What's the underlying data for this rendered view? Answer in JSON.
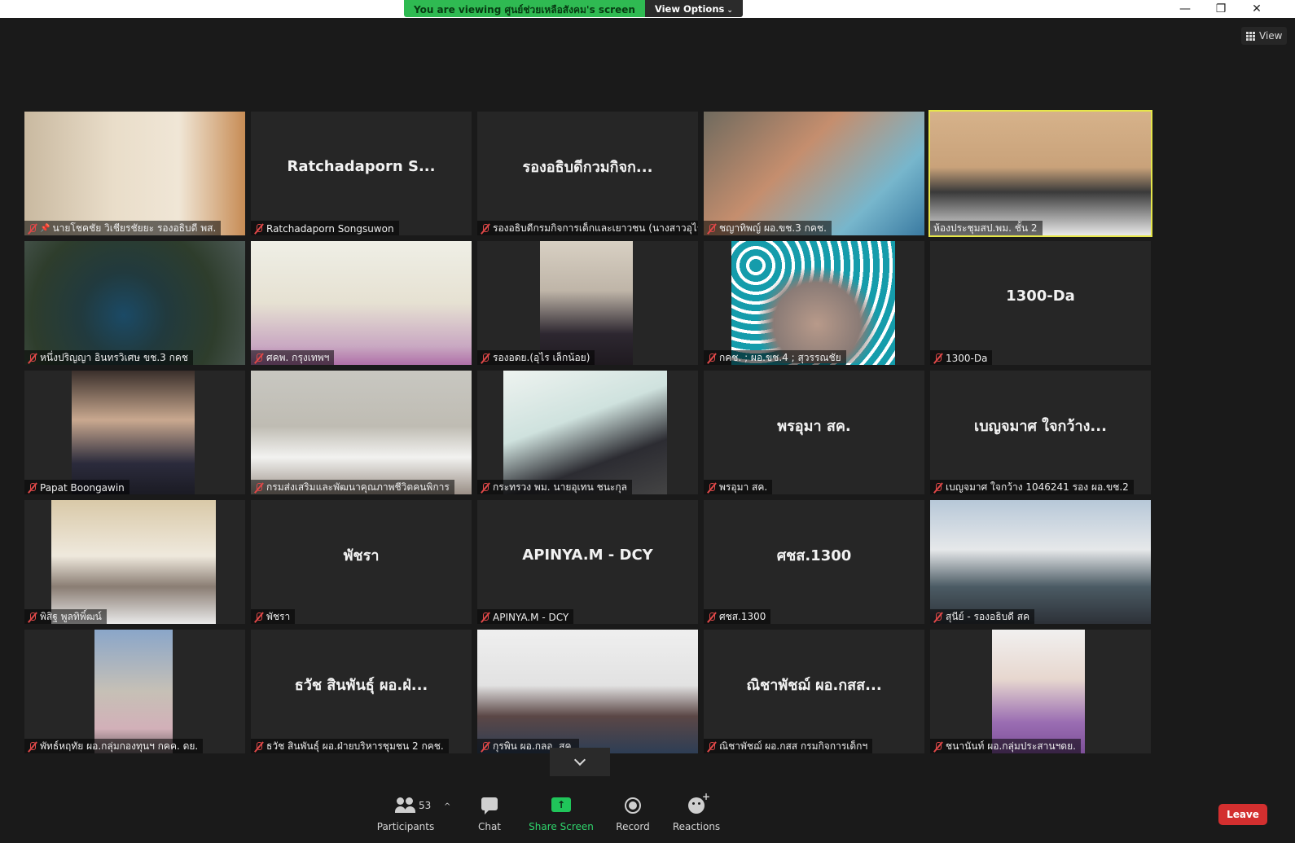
{
  "banner": {
    "text": "You are viewing ศูนย์ช่วยเหลือสังคม's screen",
    "options_label": "View Options"
  },
  "window": {
    "minimize": "—",
    "restore": "❐",
    "close": "✕"
  },
  "view_button": {
    "label": "View"
  },
  "tiles": [
    {
      "label": "นายโชคชัย วิเชียรชัยยะ รองอธิบดี พส.",
      "big": "",
      "pinned": true
    },
    {
      "label": "Ratchadaporn Songsuwon",
      "big": "Ratchadaporn S..."
    },
    {
      "label": "รองอธิบดีกรมกิจการเด็กและเยาวชน (นางสาวอุไร ...",
      "big": "รองอธิบดีกวมกิจก..."
    },
    {
      "label": "ชญาทิพญ์ ผอ.ขช.3 กคช.",
      "big": ""
    },
    {
      "label": "ห้องประชุมสป.พม. ชั้น 2",
      "big": "",
      "active": true
    },
    {
      "label": "หนึ่งปริญญา อินทรวิเศษ ขช.3 กคช",
      "big": ""
    },
    {
      "label": "ศคพ. กรุงเทพฯ",
      "big": ""
    },
    {
      "label": "รองอดย.(อุไร เล็กน้อย)",
      "big": ""
    },
    {
      "label": "กคช. ; ผอ.ขช.4 ; สุวรรณชัย",
      "big": ""
    },
    {
      "label": "1300-Da",
      "big": "1300-Da"
    },
    {
      "label": "Papat Boongawin",
      "big": ""
    },
    {
      "label": "กรมส่งเสริมและพัฒนาคุณภาพชีวิตคนพิการ",
      "big": ""
    },
    {
      "label": "กระทรวง พม. นายอุเทน ชนะกุล",
      "big": ""
    },
    {
      "label": "พรอุมา สค.",
      "big": "พรอุมา สค."
    },
    {
      "label": "เบญจมาศ ใจกว้าง 1046241 รอง ผอ.ขช.2",
      "big": "เบญจมาศ ใจกว้าง..."
    },
    {
      "label": "พิสิฐ พูลทิพิ์ฒน์",
      "big": ""
    },
    {
      "label": "พัชรา",
      "big": "พัชรา"
    },
    {
      "label": "APINYA.M - DCY",
      "big": "APINYA.M - DCY"
    },
    {
      "label": "ศชส.1300",
      "big": "ศชส.1300"
    },
    {
      "label": "สุนีย์ - รองอธิบดี สค",
      "big": ""
    },
    {
      "label": "พัทธ์หฤทัย ผอ.กลุ่มกองทุนฯ กคค. ดย.",
      "big": ""
    },
    {
      "label": "ธวัช สินพันธุ์ ผอ.ฝ่ายบริหารชุมชน 2 กคช.",
      "big": "ธวัช สินพันธุ์ ผอ.ฝ่..."
    },
    {
      "label": "กุรพิน ผอ.กลอ. สค.",
      "big": ""
    },
    {
      "label": "ณิชาพัชฌ์ ผอ.กสส กรมกิจการเด็กฯ",
      "big": "ณิชาพัชฌ์ ผอ.กสส..."
    },
    {
      "label": "ชนานันท์ ผอ.กลุ่มประสานฯดย.",
      "big": ""
    }
  ],
  "toolbar": {
    "participants_label": "Participants",
    "participants_count": "53",
    "caret": "^",
    "chat_label": "Chat",
    "share_label": "Share Screen",
    "share_icon": "↑",
    "record_label": "Record",
    "reactions_label": "Reactions",
    "leave_label": "Leave"
  }
}
